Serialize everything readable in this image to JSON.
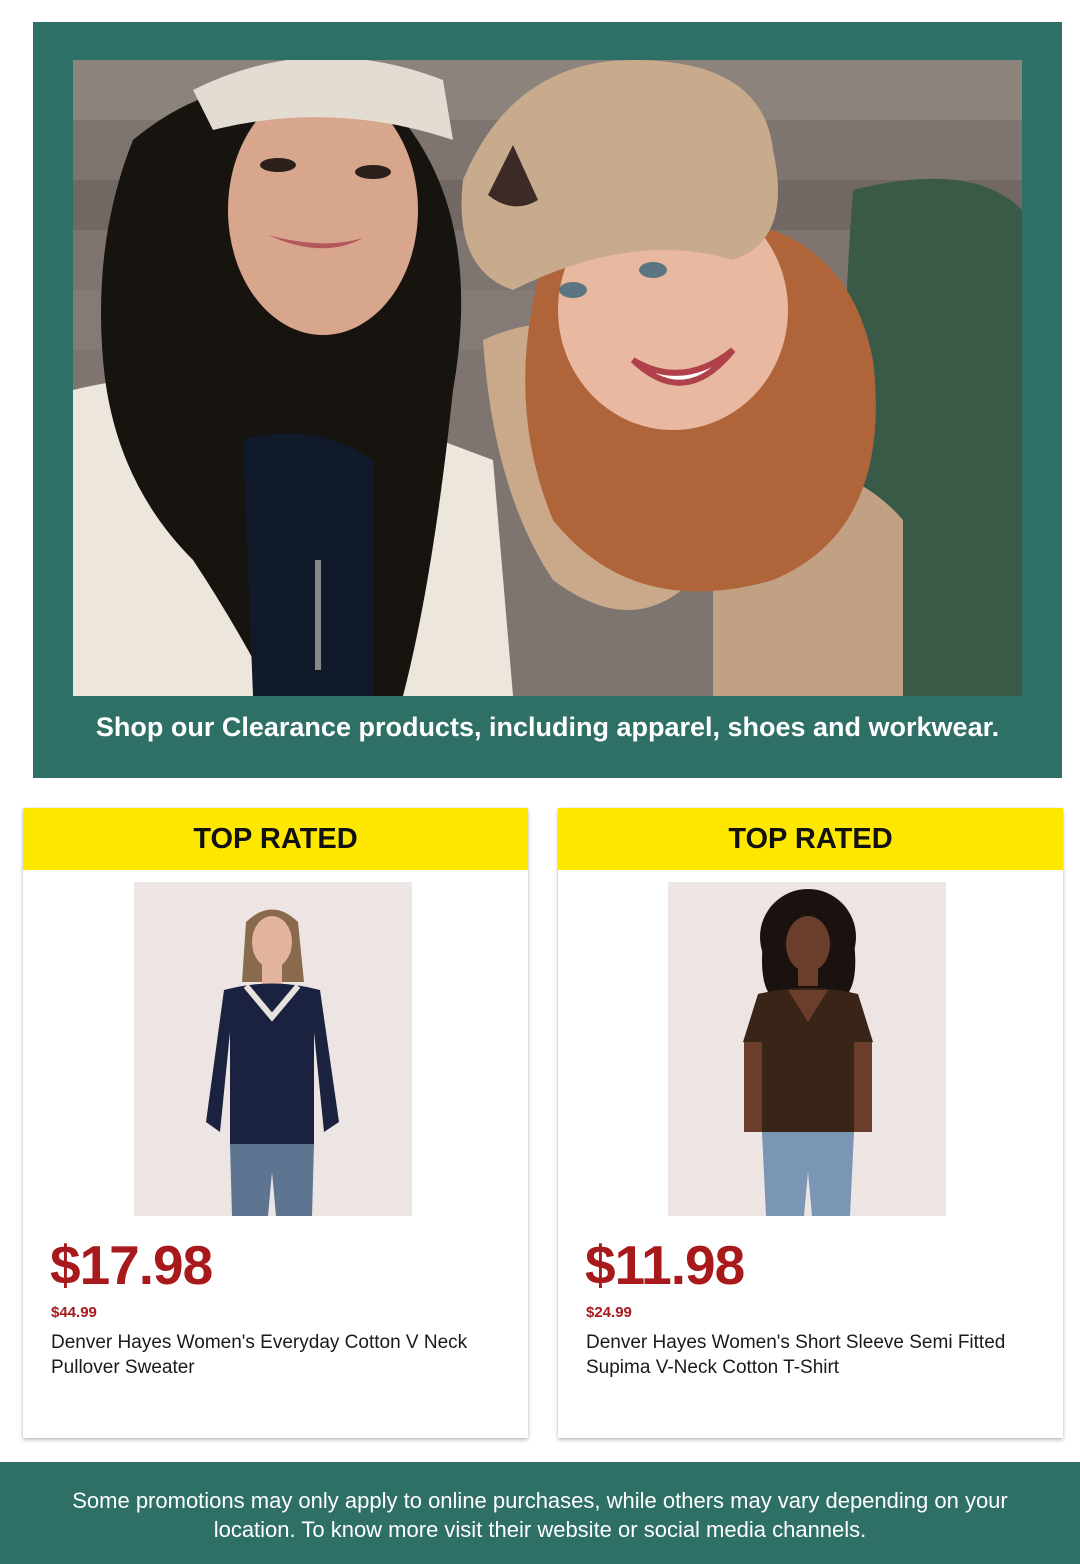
{
  "hero": {
    "caption": "Shop our Clearance products, including apparel, shoes and workwear."
  },
  "products": [
    {
      "badge": "TOP RATED",
      "price": "$17.98",
      "was_price": "$44.99",
      "name": "Denver Hayes Women's Everyday Cotton V Neck Pullover Sweater"
    },
    {
      "badge": "TOP RATED",
      "price": "$11.98",
      "was_price": "$24.99",
      "name": "Denver Hayes Women's Short Sleeve Semi Fitted Supima V-Neck Cotton T-Shirt"
    }
  ],
  "footer": {
    "text": "Some promotions may only apply to online purchases, while others may vary depending on your location. To know more visit their website or social media channels."
  },
  "colors": {
    "brand_green": "#2e6f66",
    "badge_yellow": "#ffe800",
    "price_red": "#a8191c"
  }
}
